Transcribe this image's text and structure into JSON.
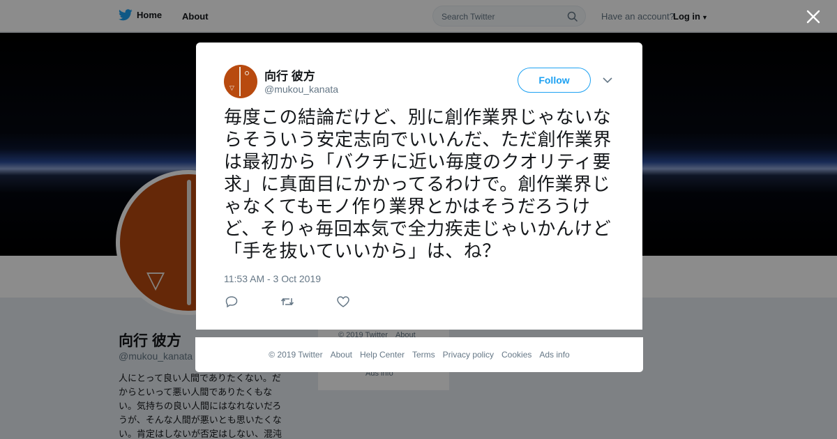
{
  "nav": {
    "home_label": "Home",
    "about_label": "About",
    "search_placeholder": "Search Twitter",
    "have_account": "Have an account?",
    "login_label": "Log in"
  },
  "profile": {
    "name": "向行 彼方",
    "handle": "@mukou_kanata",
    "bio_lines": [
      "人にとって良い人間でありたくない。だ",
      "からといって悪い人間でありたくもな",
      "い。気持ちの良い人間にはなれないだろ",
      "うが、そんな人間が悪いとも思いたくな",
      "い。肯定はしないが否定はしない、混沌"
    ]
  },
  "sidebar": {
    "copyright": "© 2019 Twitter",
    "about": "About",
    "ads_info": "Ads info"
  },
  "tweet": {
    "name": "向行 彼方",
    "handle": "@mukou_kanata",
    "follow_label": "Follow",
    "text": "毎度この結論だけど、別に創作業界じゃないならそういう安定志向でいいんだ、ただ創作業界は最初から「バクチに近い毎度のクオリティ要求」に真面目にかかってるわけで。創作業界じゃなくてもモノ作り業界とかはそうだろうけど、そりゃ毎回本気で全力疾走じゃいかんけど「手を抜いていいから」は、ね？",
    "timestamp": "11:53 AM - 3 Oct 2019"
  },
  "footer": {
    "items": [
      "© 2019 Twitter",
      "About",
      "Help Center",
      "Terms",
      "Privacy policy",
      "Cookies",
      "Ads info"
    ]
  },
  "colors": {
    "accent": "#1da1f2",
    "avatar_bg": "#b84a0f",
    "muted_text": "#657786"
  },
  "icons": [
    "twitter-bird-icon",
    "search-icon",
    "caret-down-icon",
    "close-icon",
    "reply-icon",
    "retweet-icon",
    "like-icon",
    "chevron-down-icon"
  ]
}
